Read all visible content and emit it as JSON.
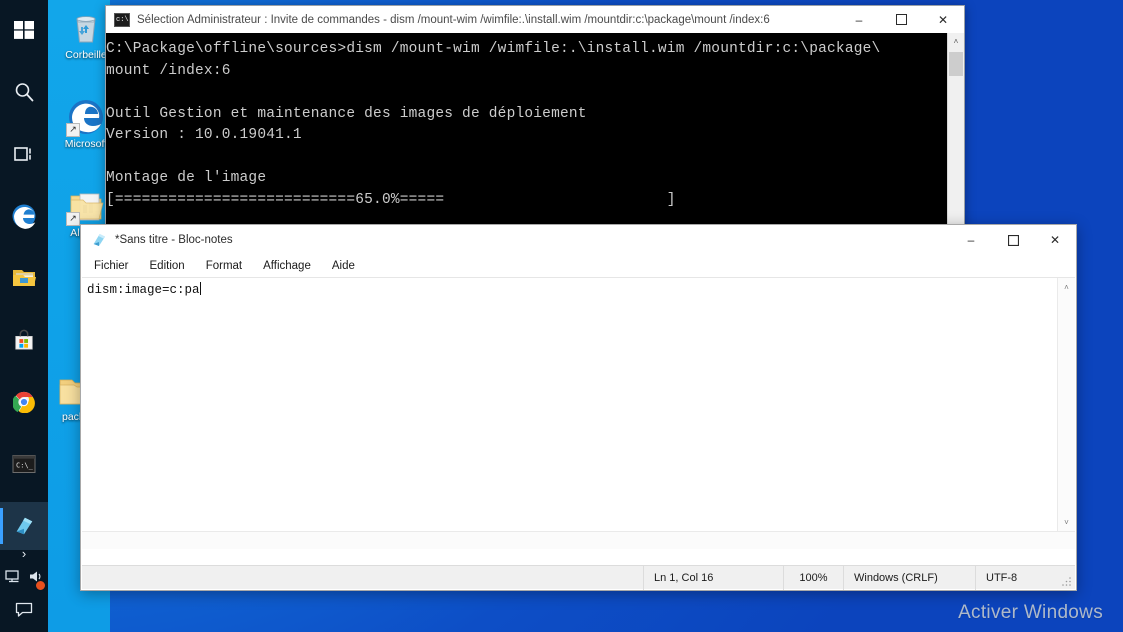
{
  "desktop": {
    "wallpaper_color": "#0f62d2",
    "accent_blue": "#0fa2e8",
    "watermark": "Activer Windows",
    "icons": [
      {
        "name": "recycle-bin",
        "label": "Corbeille",
        "icon": "recycle-bin-icon",
        "shortcut": false
      },
      {
        "name": "microsoft-edge",
        "label": "Microsoft",
        "icon": "edge-icon",
        "shortcut": true
      },
      {
        "name": "alpha-shortcut",
        "label": "Alp\nRa",
        "icon": "folder-document-icon",
        "shortcut": true
      },
      {
        "name": "package-folder",
        "label": "packa",
        "icon": "folder-icon",
        "shortcut": false
      }
    ]
  },
  "taskbar": {
    "background": "#081724",
    "items": [
      {
        "name": "start-button",
        "icon": "windows-logo-icon",
        "label": "Démarrer",
        "active": false
      },
      {
        "name": "search-button",
        "icon": "search-icon",
        "label": "Rechercher",
        "active": false
      },
      {
        "name": "task-view-button",
        "icon": "task-view-icon",
        "label": "Affichage des tâches",
        "active": false
      },
      {
        "name": "edge-button",
        "icon": "edge-icon",
        "label": "Microsoft Edge",
        "active": false
      },
      {
        "name": "file-explorer-button",
        "icon": "folder-icon",
        "label": "Explorateur de fichiers",
        "active": false
      },
      {
        "name": "microsoft-store-button",
        "icon": "store-icon",
        "label": "Microsoft Store",
        "active": false
      },
      {
        "name": "chrome-button",
        "icon": "chrome-icon",
        "label": "Google Chrome",
        "active": false
      },
      {
        "name": "command-prompt-button",
        "icon": "console-icon",
        "label": "Invite de commandes",
        "active": false
      },
      {
        "name": "notepad-button",
        "icon": "notepad-icon",
        "label": "Bloc-notes",
        "active": true
      }
    ],
    "tray": {
      "chevron": "›",
      "network_icon": "network-icon",
      "volume_icon": "volume-icon",
      "volume_badge": true,
      "action_center_icon": "action-center-icon"
    }
  },
  "cmd_window": {
    "title": "Sélection Administrateur : Invite de commandes - dism  /mount-wim /wimfile:.\\install.wim /mountdir:c:\\package\\mount /index:6",
    "title_icon": "console-icon",
    "controls": {
      "minimize": "–",
      "maximize": "☐",
      "close": "✕"
    },
    "console_output": "C:\\Package\\offline\\sources>dism /mount-wim /wimfile:.\\install.wim /mountdir:c:\\package\\\nmount /index:6\n\nOutil Gestion et maintenance des images de déploiement\nVersion : 10.0.19041.1\n\nMontage de l'image\n[===========================65.0%=====                         ]",
    "progress_percent": "65.0%",
    "progress_label": "Montage de l'image",
    "scrollbar": {
      "up": "˄",
      "down": "˅"
    }
  },
  "notepad_window": {
    "title": "*Sans titre - Bloc-notes",
    "title_icon": "notepad-icon",
    "controls": {
      "minimize": "–",
      "maximize": "☐",
      "close": "✕"
    },
    "menu": [
      {
        "name": "menu-fichier",
        "label": "Fichier"
      },
      {
        "name": "menu-edition",
        "label": "Edition"
      },
      {
        "name": "menu-format",
        "label": "Format"
      },
      {
        "name": "menu-affichage",
        "label": "Affichage"
      },
      {
        "name": "menu-aide",
        "label": "Aide"
      }
    ],
    "text_content": "dism:image=c:pa",
    "scrollbar": {
      "up": "˄",
      "down": "˅"
    },
    "statusbar": {
      "cursor_position": "Ln 1, Col 16",
      "zoom": "100%",
      "line_ending": "Windows (CRLF)",
      "encoding": "UTF-8"
    }
  }
}
